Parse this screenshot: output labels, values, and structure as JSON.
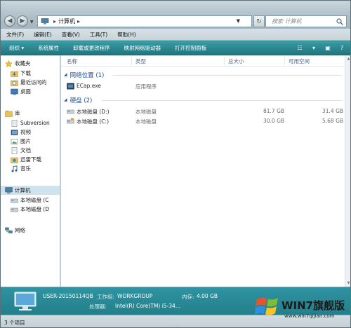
{
  "window": {
    "address_path": "计算机",
    "search_placeholder": "搜索 计算机"
  },
  "menu": [
    "文件(F)",
    "编辑(E)",
    "查看(V)",
    "工具(T)",
    "帮助(H)"
  ],
  "toolbar": {
    "organize": "组织 ▾",
    "system_properties": "系统属性",
    "uninstall": "卸载或更改程序",
    "map_drive": "映射网络驱动器",
    "control_panel": "打开控制面板"
  },
  "nav": {
    "favorites": "收藏夹",
    "favorites_items": [
      "下载",
      "最近访问的",
      "桌面"
    ],
    "libraries": "库",
    "library_items": [
      "Subversion",
      "视频",
      "图片",
      "文档",
      "迅雷下载",
      "音乐"
    ],
    "computer": "计算机",
    "computer_items": [
      "本地磁盘 (C",
      "本地磁盘 (D"
    ],
    "network": "网络"
  },
  "columns": {
    "name": "名称",
    "type": "类型",
    "total": "总大小",
    "free": "可用空间"
  },
  "groups": {
    "network": "网络位置 (1)",
    "drives": "硬盘 (2)"
  },
  "network_items": [
    {
      "name": "ECap.exe",
      "type": "应用程序"
    }
  ],
  "drives": [
    {
      "name": "本地磁盘 (D:)",
      "type": "本地磁盘",
      "total": "81.7 GB",
      "free": "31.4 GB"
    },
    {
      "name": "本地磁盘 (C:)",
      "type": "本地磁盘",
      "total": "30.0 GB",
      "free": "5.68 GB"
    }
  ],
  "details": {
    "computer_name": "USER-20150114QB",
    "workgroup_label": "工作组:",
    "workgroup": "WORKGROUP",
    "memory_label": "内存:",
    "memory": "4.00 GB",
    "cpu_label": "处理器:",
    "cpu": "Intel(R) Core(TM) i5-34..."
  },
  "status": {
    "item_count": "3 个项目"
  },
  "watermark": {
    "title": "WIN7旗舰版",
    "url": "www.win7qijian.com"
  }
}
